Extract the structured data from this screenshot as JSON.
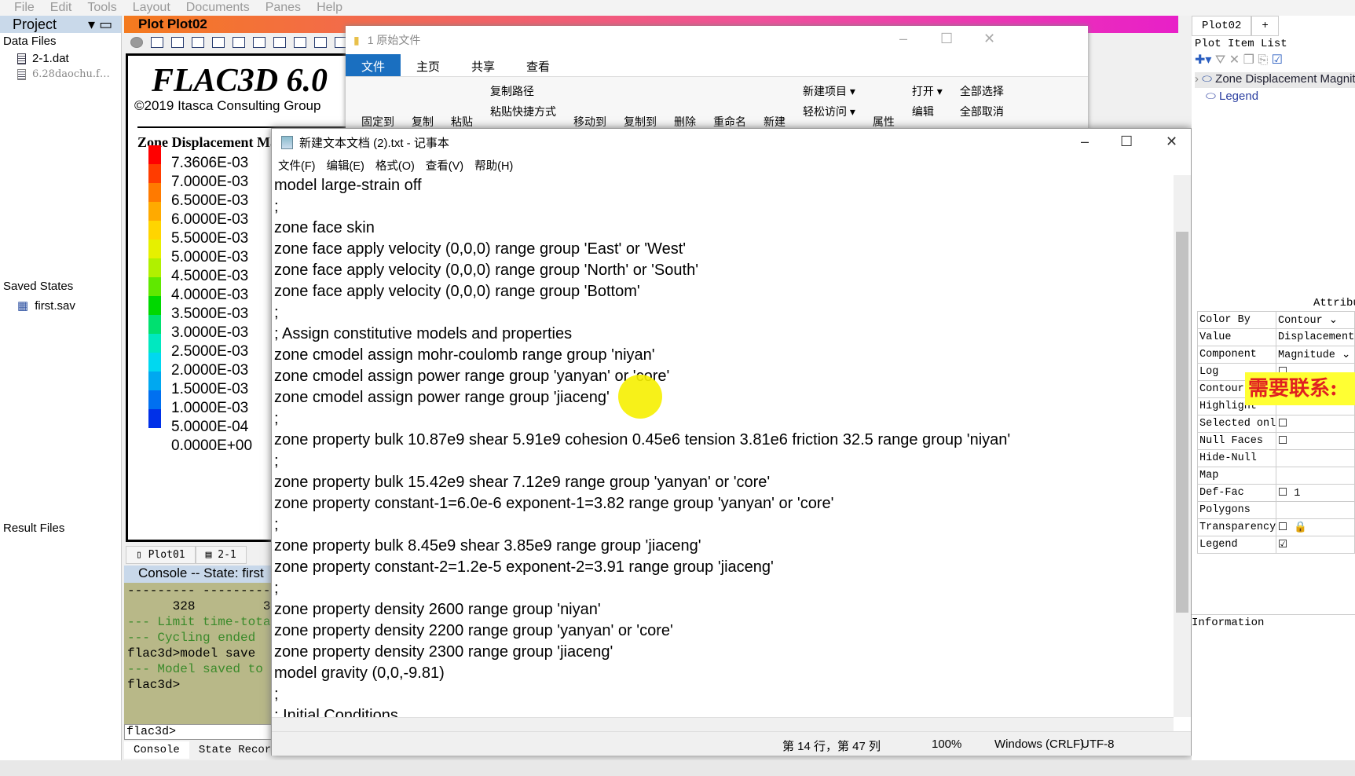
{
  "menu": [
    "File",
    "Edit",
    "Tools",
    "Layout",
    "Documents",
    "Panes",
    "Help"
  ],
  "project": {
    "title": "Project",
    "data_files": "Data Files",
    "files": [
      "2-1.dat",
      "6.28daochu.f…"
    ],
    "saved_states": "Saved States",
    "saved": "first.sav",
    "result_files": "Result Files"
  },
  "plot": {
    "title": "Plot Plot02",
    "logo": "FLAC3D 6.0",
    "copyright": "©2019 Itasca Consulting Group",
    "legend_title": "Zone Displacement Magnitude",
    "legend_values": [
      "7.3606E-03",
      "7.0000E-03",
      "6.5000E-03",
      "6.0000E-03",
      "5.5000E-03",
      "5.0000E-03",
      "4.5000E-03",
      "4.0000E-03",
      "3.5000E-03",
      "3.0000E-03",
      "2.5000E-03",
      "2.0000E-03",
      "1.5000E-03",
      "1.0000E-03",
      "5.0000E-04",
      "0.0000E+00"
    ],
    "legend_colors": [
      "#ff0000",
      "#ff3c00",
      "#ff7a00",
      "#ffaa00",
      "#ffd500",
      "#e6f000",
      "#b0f000",
      "#60e800",
      "#00d800",
      "#00e070",
      "#00e8c0",
      "#00d8f0",
      "#00a8f0",
      "#0070f0",
      "#0030e8"
    ],
    "tabs": [
      "Plot01",
      "2-1"
    ]
  },
  "console": {
    "header": "Console -- State: first",
    "lines": [
      "--------- ---------",
      "      328         3",
      "",
      "--- Limit time-total",
      "--- Cycling ended",
      "flac3d>model save",
      "--- Model saved to",
      "flac3d>"
    ],
    "prompt": "flac3d>",
    "tabs": [
      "Console",
      "State Record"
    ]
  },
  "explorer": {
    "title": "1 原始文件",
    "tabs": [
      "文件",
      "主页",
      "共享",
      "查看"
    ],
    "ribbon": [
      [
        "固定到"
      ],
      [
        "复制"
      ],
      [
        "粘贴"
      ],
      [
        "复制路径",
        "粘贴快捷方式"
      ],
      [
        "移动到"
      ],
      [
        "复制到"
      ],
      [
        "删除"
      ],
      [
        "重命名"
      ],
      [
        "新建"
      ],
      [
        "新建项目 ▾",
        "轻松访问 ▾"
      ],
      [
        "属性"
      ],
      [
        "打开 ▾",
        "编辑"
      ],
      [
        "全部选择",
        "全部取消"
      ]
    ]
  },
  "notepad": {
    "title": "新建文本文档 (2).txt - 记事本",
    "menu": [
      "文件(F)",
      "编辑(E)",
      "格式(O)",
      "查看(V)",
      "帮助(H)"
    ],
    "lines": [
      "model large-strain off",
      ";",
      "zone face skin",
      "zone face apply velocity (0,0,0) range group 'East' or 'West'",
      "zone face apply velocity (0,0,0) range group 'North' or 'South'",
      "zone face apply velocity (0,0,0) range group 'Bottom'",
      ";",
      "; Assign constitutive models and properties",
      "zone cmodel assign mohr-coulomb range group 'niyan'",
      "zone cmodel assign power range group 'yanyan' or 'core'",
      "zone cmodel assign power range group 'jiaceng'",
      ";",
      "zone property bulk 10.87e9 shear 5.91e9 cohesion 0.45e6 tension 3.81e6 friction 32.5 range group 'niyan'",
      ";",
      "zone property bulk 15.42e9 shear 7.12e9 range group 'yanyan' or 'core'",
      "zone property constant-1=6.0e-6 exponent-1=3.82 range group 'yanyan' or 'core'",
      ";",
      "zone property bulk 8.45e9 shear 3.85e9 range group 'jiaceng'",
      "zone property constant-2=1.2e-5 exponent-2=3.91 range group 'jiaceng'",
      ";",
      "zone property density 2600 range group 'niyan'",
      "zone property density 2200 range group 'yanyan' or 'core'",
      "zone property density 2300 range group 'jiaceng'",
      "model gravity (0,0,-9.81)",
      ";",
      "; Initial Conditions"
    ],
    "status": {
      "position": "第 14 行，第 47 列",
      "zoom": "100%",
      "eol": "Windows (CRLF)",
      "encoding": "UTF-8"
    }
  },
  "right": {
    "tab": "Plot02",
    "tab_add": "+",
    "list_title": "Plot Item List",
    "items": [
      "Zone Displacement Magnitude",
      "Legend"
    ],
    "attr_title": "Attributes",
    "attrs": [
      [
        "Color By",
        "Contour ⌄"
      ],
      [
        "Value",
        "Displacement"
      ],
      [
        "Component",
        "Magnitude ⌄"
      ],
      [
        "Log",
        "☐"
      ],
      [
        "Contour",
        ""
      ],
      [
        "Highlight",
        ""
      ],
      [
        "Selected only",
        "☐"
      ],
      [
        "Null Faces",
        "☐"
      ],
      [
        "Hide-Null",
        ""
      ],
      [
        "Map",
        ""
      ],
      [
        "Def-Fac",
        "☐ 1"
      ],
      [
        "Polygons",
        ""
      ],
      [
        "Transparency",
        "☐ 🔒"
      ],
      [
        "Legend",
        "☑"
      ]
    ],
    "information": "Information"
  },
  "banner": "需要联系:"
}
